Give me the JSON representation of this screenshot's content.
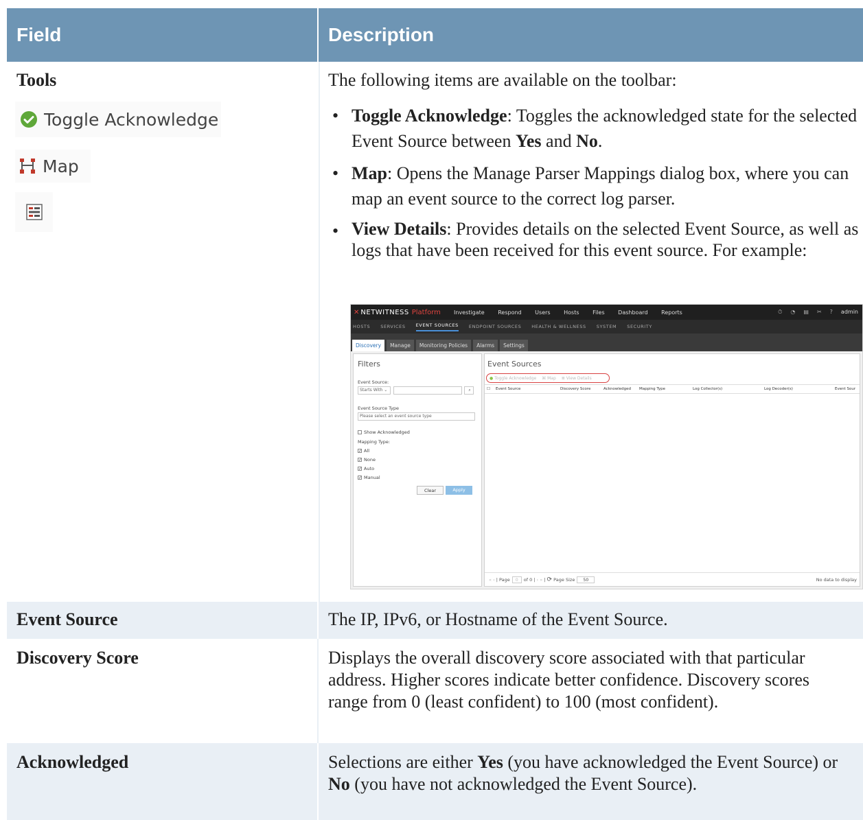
{
  "header": {
    "field": "Field",
    "description": "Description"
  },
  "tools": {
    "field": "Tools",
    "toggle_label": "Toggle Acknowledge",
    "map_label": "Map",
    "intro": "The following items are available on the toolbar:",
    "bullets": [
      {
        "term": "Toggle Acknowledge",
        "text_a": ": Toggles the acknowledged state for the selected Event Source between ",
        "yes": "Yes",
        "and": " and ",
        "no": "No",
        "end": "."
      },
      {
        "term": "Map",
        "text": ": Opens the Manage Parser Mappings dialog box, where you can map an event source to the correct log parser."
      },
      {
        "term": "View Details",
        "text": ": Provides details on the selected Event Source, as well as logs that have been received for this event source. For example:"
      }
    ]
  },
  "screenshot": {
    "brand": "NETWITNESS",
    "platform": "Platform",
    "menu": [
      "Investigate",
      "Respond",
      "Users",
      "Hosts",
      "Files",
      "Dashboard",
      "Reports"
    ],
    "user": "admin",
    "subnav": [
      "HOSTS",
      "SERVICES",
      "EVENT SOURCES",
      "ENDPOINT SOURCES",
      "HEALTH & WELLNESS",
      "SYSTEM",
      "SECURITY"
    ],
    "tabs": [
      "Discovery",
      "Manage",
      "Monitoring Policies",
      "Alarms",
      "Settings"
    ],
    "filters": {
      "title": "Filters",
      "event_source_label": "Event Source:",
      "starts_with": "Starts With",
      "type_label": "Event Source Type",
      "type_placeholder": "Please select an event source type",
      "show_ack": "Show Acknowledged",
      "mapping_label": "Mapping Type:",
      "mapping_options": [
        "All",
        "None",
        "Auto",
        "Manual"
      ],
      "clear": "Clear",
      "apply": "Apply"
    },
    "grid": {
      "title": "Event Sources",
      "toolbar": [
        "Toggle Acknowledge",
        "Map",
        "View Details"
      ],
      "columns": [
        "Event Source",
        "Discovery Score",
        "Acknowledged",
        "Mapping Type",
        "Log Collector(s)",
        "Log Decoder(s)",
        "Event Sour"
      ],
      "page_label": "Page",
      "page_value": "0",
      "of_label": "of 0",
      "page_size_label": "Page Size",
      "page_size": "50",
      "no_data": "No data to display"
    }
  },
  "rows": {
    "event_source": {
      "field": "Event Source",
      "desc": "The IP, IPv6, or Hostname of the Event Source."
    },
    "discovery_score": {
      "field": "Discovery Score",
      "desc": "Displays the overall discovery score associated with that particular address. Higher scores indicate better confidence. Discovery scores range from 0 (least confident) to 100 (most confident)."
    },
    "acknowledged": {
      "field": "Acknowledged",
      "desc_a": "Selections are either ",
      "yes": "Yes",
      "desc_b": " (you have acknowledged the Event Source) or",
      "no": "No",
      "desc_c": " (you have not acknowledged the Event Source)."
    }
  },
  "colors": {
    "header_bg": "#6e95b4",
    "row_shade": "#e9eff5"
  }
}
